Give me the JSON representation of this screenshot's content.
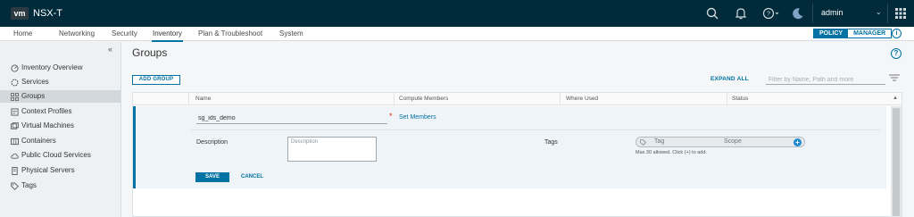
{
  "header": {
    "logo": "vm",
    "app_title": "NSX-T",
    "user": "admin",
    "icons": [
      "search-icon",
      "bell-icon",
      "help-icon",
      "moon-icon",
      "apps-grid-icon"
    ]
  },
  "nav": {
    "tabs": [
      "Home",
      "Networking",
      "Security",
      "Inventory",
      "Plan & Troubleshoot",
      "System"
    ],
    "active_tab": "Inventory",
    "mode_toggle": {
      "policy": "POLICY",
      "manager": "MANAGER",
      "selected": "POLICY"
    }
  },
  "sidebar": {
    "items": [
      {
        "label": "Inventory Overview",
        "icon": "dashboard-icon"
      },
      {
        "label": "Services",
        "icon": "services-icon"
      },
      {
        "label": "Groups",
        "icon": "groups-icon"
      },
      {
        "label": "Context Profiles",
        "icon": "context-profiles-icon"
      },
      {
        "label": "Virtual Machines",
        "icon": "virtual-machine-icon"
      },
      {
        "label": "Containers",
        "icon": "containers-icon"
      },
      {
        "label": "Public Cloud Services",
        "icon": "cloud-icon"
      },
      {
        "label": "Physical Servers",
        "icon": "server-icon"
      },
      {
        "label": "Tags",
        "icon": "tag-icon"
      }
    ],
    "active_item": "Groups"
  },
  "main": {
    "title": "Groups",
    "add_group_label": "ADD GROUP",
    "expand_all_label": "EXPAND ALL",
    "filter_placeholder": "Filter by Name, Path and more",
    "columns": [
      "Name",
      "Compute Members",
      "Where Used",
      "Status"
    ],
    "edit_row": {
      "name_value": "sg_ids_demo",
      "set_members_label": "Set Members",
      "description_label": "Description",
      "description_placeholder": "Description",
      "tags_label": "Tags",
      "tag_placeholder": "Tag",
      "scope_placeholder": "Scope",
      "tags_hint": "Max 30 allowed. Click (+) to add.",
      "save_label": "SAVE",
      "cancel_label": "CANCEL"
    }
  },
  "colors": {
    "header_bg": "#012a3a",
    "accent": "#0072a3",
    "required": "#e12200"
  }
}
